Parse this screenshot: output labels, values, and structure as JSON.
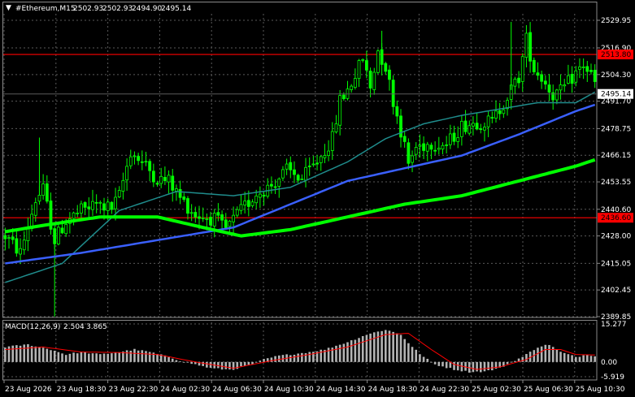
{
  "header": {
    "symbol_label": "#Ethereum,M15",
    "ohlc": [
      "2502.93",
      "2502.93",
      "2494.90",
      "2495.14"
    ]
  },
  "macd_header": {
    "label": "MACD(12,26,9)",
    "values": [
      "2.504",
      "3.865"
    ]
  },
  "colors": {
    "background": "#000000",
    "grid": "#5a5a5a",
    "candle": "#00ff00",
    "hline": "#ff0000",
    "ma_slow": "#00ff00",
    "ma_mid": "#3a60ff",
    "ma_fast": "#1f8c8c",
    "macd_hist": "#b4b4b4",
    "macd_signal": "#ff0000"
  },
  "chart_data": [
    {
      "type": "candlestick",
      "panel": "price",
      "y_ticks": [
        "2529.95",
        "2516.90",
        "2504.30",
        "2491.70",
        "2478.75",
        "2466.15",
        "2453.55",
        "2440.60",
        "2428.00",
        "2415.05",
        "2402.45",
        "2389.85"
      ],
      "ylim": [
        2389.85,
        2529.95
      ],
      "x_ticks": [
        "23 Aug 2026",
        "23 Aug 18:30",
        "23 Aug 22:30",
        "24 Aug 02:30",
        "24 Aug 06:30",
        "24 Aug 10:30",
        "24 Aug 14:30",
        "24 Aug 18:30",
        "24 Aug 22:30",
        "25 Aug 02:30",
        "25 Aug 06:30",
        "25 Aug 10:30"
      ],
      "horizontal_lines": [
        {
          "value": 2513.8,
          "label": "2513.80"
        },
        {
          "value": 2436.6,
          "label": "2436.60"
        }
      ],
      "current_price": "2495.14",
      "candle_key_path": [
        [
          0,
          2428
        ],
        [
          4,
          2420
        ],
        [
          8,
          2445
        ],
        [
          10,
          2450
        ],
        [
          13,
          2426
        ],
        [
          16,
          2435
        ],
        [
          20,
          2440
        ],
        [
          24,
          2443
        ],
        [
          28,
          2441
        ],
        [
          30,
          2447
        ],
        [
          33,
          2468
        ],
        [
          37,
          2461
        ],
        [
          40,
          2455
        ],
        [
          43,
          2454
        ],
        [
          46,
          2446
        ],
        [
          50,
          2438
        ],
        [
          55,
          2436
        ],
        [
          58,
          2431
        ],
        [
          62,
          2440
        ],
        [
          66,
          2448
        ],
        [
          70,
          2452
        ],
        [
          74,
          2459
        ],
        [
          78,
          2455
        ],
        [
          82,
          2463
        ],
        [
          86,
          2474
        ],
        [
          88,
          2492
        ],
        [
          90,
          2497
        ],
        [
          92,
          2504
        ],
        [
          94,
          2512
        ],
        [
          96,
          2498
        ],
        [
          98,
          2516
        ],
        [
          100,
          2508
        ],
        [
          102,
          2492
        ],
        [
          104,
          2478
        ],
        [
          106,
          2462
        ],
        [
          108,
          2470
        ],
        [
          112,
          2472
        ],
        [
          116,
          2471
        ],
        [
          120,
          2480
        ],
        [
          124,
          2482
        ],
        [
          128,
          2482
        ],
        [
          132,
          2494
        ],
        [
          135,
          2503
        ],
        [
          137,
          2521
        ],
        [
          139,
          2507
        ],
        [
          141,
          2503
        ],
        [
          144,
          2495
        ],
        [
          146,
          2496
        ],
        [
          150,
          2505
        ],
        [
          152,
          2509
        ],
        [
          154,
          2504
        ],
        [
          155,
          2500
        ]
      ],
      "series": [
        {
          "kind": "moving-average",
          "color": "#00ff00",
          "values": [
            [
              0,
              2430
            ],
            [
              10,
              2433
            ],
            [
              25,
              2437
            ],
            [
              40,
              2437
            ],
            [
              52,
              2432
            ],
            [
              62,
              2428
            ],
            [
              75,
              2431
            ],
            [
              90,
              2437
            ],
            [
              105,
              2443
            ],
            [
              120,
              2447
            ],
            [
              135,
              2454
            ],
            [
              150,
              2461
            ],
            [
              155,
              2464
            ]
          ]
        },
        {
          "kind": "moving-average",
          "color": "#3a60ff",
          "values": [
            [
              0,
              2415
            ],
            [
              20,
              2420
            ],
            [
              40,
              2426
            ],
            [
              60,
              2432
            ],
            [
              75,
              2443
            ],
            [
              90,
              2454
            ],
            [
              105,
              2460
            ],
            [
              120,
              2466
            ],
            [
              135,
              2476
            ],
            [
              150,
              2487
            ],
            [
              155,
              2490
            ]
          ]
        },
        {
          "kind": "moving-average",
          "color": "#1f8c8c",
          "values": [
            [
              0,
              2406
            ],
            [
              15,
              2415
            ],
            [
              30,
              2440
            ],
            [
              45,
              2449
            ],
            [
              60,
              2447
            ],
            [
              75,
              2451
            ],
            [
              90,
              2463
            ],
            [
              100,
              2474
            ],
            [
              110,
              2481
            ],
            [
              120,
              2485
            ],
            [
              130,
              2488
            ],
            [
              140,
              2491
            ],
            [
              150,
              2491
            ],
            [
              155,
              2496
            ]
          ]
        }
      ]
    },
    {
      "type": "bar",
      "panel": "macd",
      "title": "MACD(12,26,9)",
      "y_ticks": [
        "15.277",
        "0.00",
        "-5.919"
      ],
      "ylim": [
        -5.919,
        15.277
      ],
      "histogram_key_path": [
        [
          0,
          6
        ],
        [
          6,
          7
        ],
        [
          12,
          5
        ],
        [
          16,
          3
        ],
        [
          20,
          4
        ],
        [
          25,
          3
        ],
        [
          30,
          4
        ],
        [
          34,
          5
        ],
        [
          38,
          4
        ],
        [
          43,
          2
        ],
        [
          46,
          0.5
        ],
        [
          50,
          -1
        ],
        [
          54,
          -2.5
        ],
        [
          58,
          -3
        ],
        [
          60,
          -3
        ],
        [
          62,
          -2
        ],
        [
          65,
          -1
        ],
        [
          68,
          1
        ],
        [
          72,
          2.5
        ],
        [
          76,
          3.2
        ],
        [
          80,
          4
        ],
        [
          84,
          5
        ],
        [
          90,
          8
        ],
        [
          95,
          11
        ],
        [
          100,
          13
        ],
        [
          104,
          11
        ],
        [
          107,
          6
        ],
        [
          110,
          2
        ],
        [
          113,
          -1
        ],
        [
          118,
          -3
        ],
        [
          122,
          -4
        ],
        [
          126,
          -3.8
        ],
        [
          130,
          -2.5
        ],
        [
          133,
          0
        ],
        [
          136,
          2
        ],
        [
          138,
          4
        ],
        [
          140,
          6
        ],
        [
          143,
          7
        ],
        [
          146,
          4
        ],
        [
          150,
          2
        ],
        [
          153,
          3
        ],
        [
          155,
          2.5
        ]
      ],
      "signal_key_path": [
        [
          0,
          5
        ],
        [
          10,
          6
        ],
        [
          20,
          4
        ],
        [
          30,
          3.8
        ],
        [
          40,
          3
        ],
        [
          50,
          0
        ],
        [
          60,
          -2.5
        ],
        [
          70,
          0.5
        ],
        [
          80,
          3
        ],
        [
          90,
          6
        ],
        [
          100,
          11
        ],
        [
          106,
          11.5
        ],
        [
          112,
          5
        ],
        [
          118,
          -1
        ],
        [
          124,
          -3
        ],
        [
          130,
          -2
        ],
        [
          137,
          1
        ],
        [
          142,
          5
        ],
        [
          146,
          5
        ],
        [
          150,
          3
        ],
        [
          155,
          2.8
        ]
      ]
    }
  ]
}
